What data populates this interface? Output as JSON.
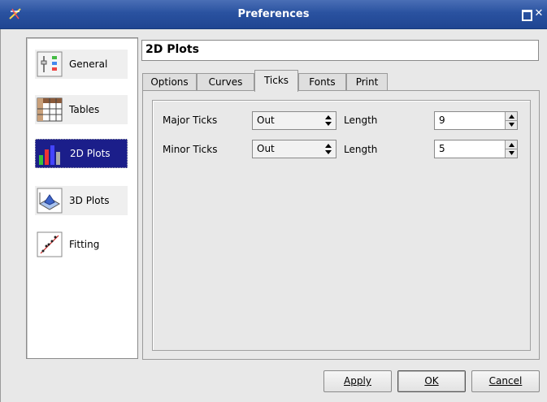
{
  "window": {
    "title": "Preferences"
  },
  "categories": [
    {
      "label": "General",
      "icon": "general-settings-icon"
    },
    {
      "label": "Tables",
      "icon": "table-icon"
    },
    {
      "label": "2D Plots",
      "icon": "bar-chart-icon",
      "selected": true
    },
    {
      "label": "3D Plots",
      "icon": "surface-plot-icon"
    },
    {
      "label": "Fitting",
      "icon": "fitting-icon"
    }
  ],
  "page": {
    "heading": "2D Plots"
  },
  "tabs": [
    {
      "label": "Options"
    },
    {
      "label": "Curves"
    },
    {
      "label": "Ticks",
      "active": true
    },
    {
      "label": "Fonts"
    },
    {
      "label": "Print"
    }
  ],
  "ticks": {
    "major": {
      "label": "Major Ticks",
      "direction": "Out",
      "length_label": "Length",
      "length": "9"
    },
    "minor": {
      "label": "Minor Ticks",
      "direction": "Out",
      "length_label": "Length",
      "length": "5"
    }
  },
  "buttons": {
    "apply": "Apply",
    "ok": "OK",
    "cancel": "Cancel"
  },
  "colors": {
    "titlebar": "#2a52a0",
    "selection": "#1b1e8a"
  }
}
